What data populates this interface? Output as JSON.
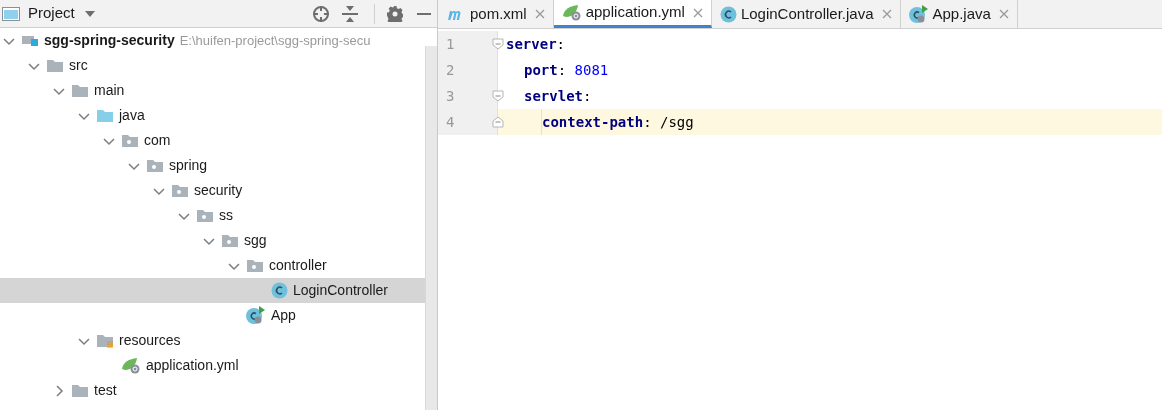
{
  "project_panel": {
    "title": "Project",
    "tree": [
      {
        "name": "sgg-spring-security",
        "path": "E:\\huifen-project\\sgg-spring-secu",
        "kind": "module",
        "expanded": true,
        "selected": false,
        "children": [
          {
            "name": "src",
            "kind": "folder",
            "expanded": true,
            "selected": false,
            "children": [
              {
                "name": "main",
                "kind": "folder",
                "expanded": true,
                "selected": false,
                "children": [
                  {
                    "name": "java",
                    "kind": "source_folder",
                    "expanded": true,
                    "selected": false,
                    "children": [
                      {
                        "name": "com",
                        "kind": "package",
                        "expanded": true,
                        "selected": false,
                        "children": [
                          {
                            "name": "spring",
                            "kind": "package",
                            "expanded": true,
                            "selected": false,
                            "children": [
                              {
                                "name": "security",
                                "kind": "package",
                                "expanded": true,
                                "selected": false,
                                "children": [
                                  {
                                    "name": "ss",
                                    "kind": "package",
                                    "expanded": true,
                                    "selected": false,
                                    "children": [
                                      {
                                        "name": "sgg",
                                        "kind": "package",
                                        "expanded": true,
                                        "selected": false,
                                        "children": [
                                          {
                                            "name": "controller",
                                            "kind": "package",
                                            "expanded": true,
                                            "selected": false,
                                            "children": [
                                              {
                                                "name": "LoginController",
                                                "kind": "class",
                                                "selected": true
                                              }
                                            ]
                                          },
                                          {
                                            "name": "App",
                                            "kind": "app_class",
                                            "selected": false
                                          }
                                        ]
                                      }
                                    ]
                                  }
                                ]
                              }
                            ]
                          }
                        ]
                      }
                    ]
                  },
                  {
                    "name": "resources",
                    "kind": "resource_folder",
                    "expanded": true,
                    "selected": false,
                    "children": [
                      {
                        "name": "application.yml",
                        "kind": "yaml",
                        "selected": false
                      }
                    ]
                  }
                ]
              },
              {
                "name": "test",
                "kind": "folder",
                "expanded": false,
                "selected": false
              }
            ]
          }
        ]
      }
    ]
  },
  "editor": {
    "tabs": [
      {
        "label": "pom.xml",
        "kind": "maven",
        "selected": false
      },
      {
        "label": "application.yml",
        "kind": "yaml",
        "selected": true
      },
      {
        "label": "LoginController.java",
        "kind": "class",
        "selected": false
      },
      {
        "label": "App.java",
        "kind": "app_class",
        "selected": false
      }
    ],
    "lines": [
      {
        "number": "1",
        "current": false,
        "tokens": [
          {
            "kind": "key",
            "text": "server"
          },
          {
            "kind": "punct",
            "text": ":"
          }
        ],
        "children": [
          {
            "number": "2",
            "current": false,
            "tokens": [
              {
                "kind": "key",
                "text": "port"
              },
              {
                "kind": "punct",
                "text": ": "
              },
              {
                "kind": "number",
                "text": "8081"
              }
            ]
          },
          {
            "number": "3",
            "current": false,
            "tokens": [
              {
                "kind": "key",
                "text": "servlet"
              },
              {
                "kind": "punct",
                "text": ":"
              }
            ],
            "children": [
              {
                "number": "4",
                "current": true,
                "tokens": [
                  {
                    "kind": "key",
                    "text": "context-path"
                  },
                  {
                    "kind": "punct",
                    "text": ": "
                  },
                  {
                    "kind": "plain",
                    "text": "/sgg"
                  }
                ]
              }
            ]
          }
        ]
      }
    ]
  }
}
